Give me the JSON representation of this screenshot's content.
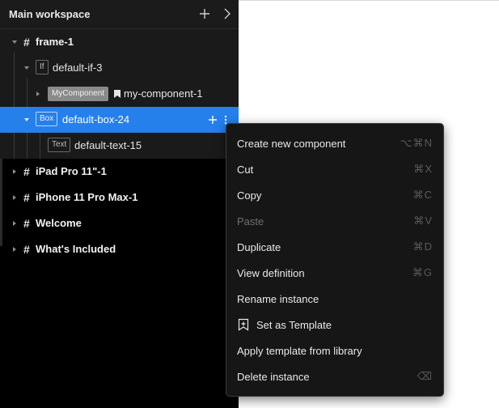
{
  "panel": {
    "title": "Main workspace",
    "icons": {
      "add": "plus-icon",
      "expand": "chevron-right-icon"
    }
  },
  "tree": {
    "rows": [
      {
        "type": "frame",
        "label": "frame-1",
        "expanded": true
      },
      {
        "type": "if",
        "tag": "If",
        "label": "default-if-3",
        "expanded": true
      },
      {
        "type": "component",
        "tag": "MyComponent",
        "label": "my-component-1",
        "icon": "bookmark-icon",
        "expanded": false
      },
      {
        "type": "box",
        "tag": "Box",
        "label": "default-box-24",
        "expanded": true,
        "selected": true,
        "actions": [
          "plus-icon",
          "more-vertical-icon"
        ]
      },
      {
        "type": "text",
        "tag": "Text",
        "label": "default-text-15"
      },
      {
        "type": "frame",
        "label": "iPad Pro 11\"-1",
        "expanded": false
      },
      {
        "type": "frame",
        "label": "iPhone 11 Pro Max-1",
        "expanded": false
      },
      {
        "type": "frame",
        "label": "Welcome",
        "expanded": false
      },
      {
        "type": "frame",
        "label": "What's Included",
        "expanded": false
      }
    ],
    "frame_glyph": "#"
  },
  "context_menu": {
    "items": [
      {
        "label": "Create new component",
        "shortcut": "⌥⌘N",
        "enabled": true
      },
      {
        "label": "Cut",
        "shortcut": "⌘X",
        "enabled": true
      },
      {
        "label": "Copy",
        "shortcut": "⌘C",
        "enabled": true
      },
      {
        "label": "Paste",
        "shortcut": "⌘V",
        "enabled": false
      },
      {
        "label": "Duplicate",
        "shortcut": "⌘D",
        "enabled": true
      },
      {
        "label": "View definition",
        "shortcut": "⌘G",
        "enabled": true
      },
      {
        "label": "Rename instance",
        "shortcut": "",
        "enabled": true
      },
      {
        "label": "Set as Template",
        "shortcut": "",
        "enabled": true,
        "icon": "bookmark-plus-icon"
      },
      {
        "label": "Apply template from library",
        "shortcut": "",
        "enabled": true
      },
      {
        "label": "Delete instance",
        "shortcut": "⌫",
        "enabled": true
      }
    ]
  },
  "colors": {
    "panel_bg": "#000000",
    "header_bg": "#1b1b1b",
    "group_bg": "#1a1a1a",
    "selection": "#2680eb",
    "menu_bg": "#161616",
    "canvas": "#ffffff"
  }
}
